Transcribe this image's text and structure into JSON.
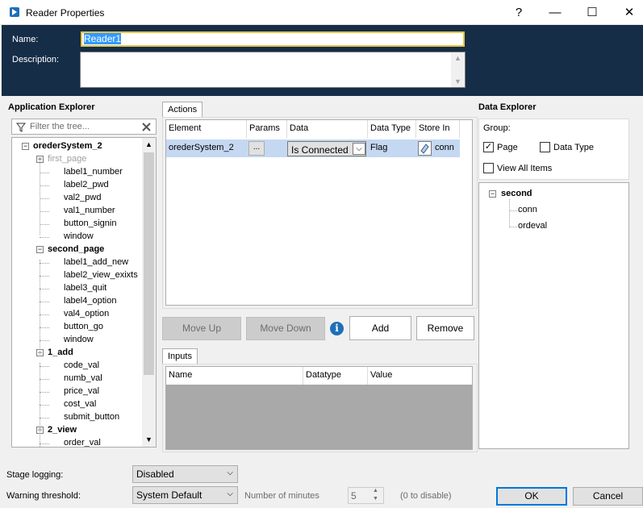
{
  "window": {
    "title": "Reader Properties",
    "help": "?",
    "minimize": "—",
    "maximize": "☐",
    "close": "✕"
  },
  "header": {
    "name_label": "Name:",
    "name_value": "Reader1",
    "description_label": "Description:",
    "description_value": ""
  },
  "app_explorer": {
    "title": "Application Explorer",
    "filter_placeholder": "Filter the tree...",
    "tree": [
      {
        "label": "orederSystem_2",
        "level": 0,
        "bold": true,
        "expander": "−"
      },
      {
        "label": "first_page",
        "level": 1,
        "gray": true,
        "expander": "−"
      },
      {
        "label": "label1_number",
        "level": 2
      },
      {
        "label": "label2_pwd",
        "level": 2
      },
      {
        "label": "val2_pwd",
        "level": 2
      },
      {
        "label": "val1_number",
        "level": 2
      },
      {
        "label": "button_signin",
        "level": 2
      },
      {
        "label": "window",
        "level": 2
      },
      {
        "label": "second_page",
        "level": 1,
        "bold": true,
        "expander": "−"
      },
      {
        "label": "label1_add_new",
        "level": 2
      },
      {
        "label": "label2_view_exixts",
        "level": 2
      },
      {
        "label": "label3_quit",
        "level": 2
      },
      {
        "label": "label4_option",
        "level": 2
      },
      {
        "label": "val4_option",
        "level": 2
      },
      {
        "label": "button_go",
        "level": 2
      },
      {
        "label": "window",
        "level": 2
      },
      {
        "label": "1_add",
        "level": 1,
        "bold": true,
        "expander": "−"
      },
      {
        "label": "code_val",
        "level": 2
      },
      {
        "label": "numb_val",
        "level": 2
      },
      {
        "label": "price_val",
        "level": 2
      },
      {
        "label": "cost_val",
        "level": 2
      },
      {
        "label": "submit_button",
        "level": 2
      },
      {
        "label": "2_view",
        "level": 1,
        "bold": true,
        "expander": "−"
      },
      {
        "label": "order_val",
        "level": 2
      }
    ]
  },
  "actions": {
    "tab": "Actions",
    "columns": [
      "Element",
      "Params",
      "Data",
      "Data Type",
      "Store In"
    ],
    "row": {
      "element": "orederSystem_2",
      "params": "...",
      "data": "Is Connected",
      "data_type": "Flag",
      "store_in": "conn"
    },
    "move_up": "Move Up",
    "move_down": "Move Down",
    "info_icon": "i",
    "add": "Add",
    "remove": "Remove"
  },
  "inputs": {
    "tab": "Inputs",
    "columns": [
      "Name",
      "Datatype",
      "Value"
    ]
  },
  "data_explorer": {
    "title": "Data Explorer",
    "group_label": "Group:",
    "page_label": "Page",
    "page_checked": true,
    "data_type_label": "Data Type",
    "data_type_checked": false,
    "view_all_label": "View All Items",
    "view_all_checked": false,
    "tree": [
      {
        "label": "second",
        "level": 0,
        "expander": "−"
      },
      {
        "label": "conn",
        "level": 1
      },
      {
        "label": "ordeval",
        "level": 1
      }
    ]
  },
  "footer": {
    "stage_logging_label": "Stage logging:",
    "stage_logging_value": "Disabled",
    "warning_label": "Warning threshold:",
    "warning_value": "System Default",
    "minutes_label": "Number of minutes",
    "minutes_value": "5",
    "hint": "(0 to disable)",
    "ok": "OK",
    "cancel": "Cancel"
  }
}
